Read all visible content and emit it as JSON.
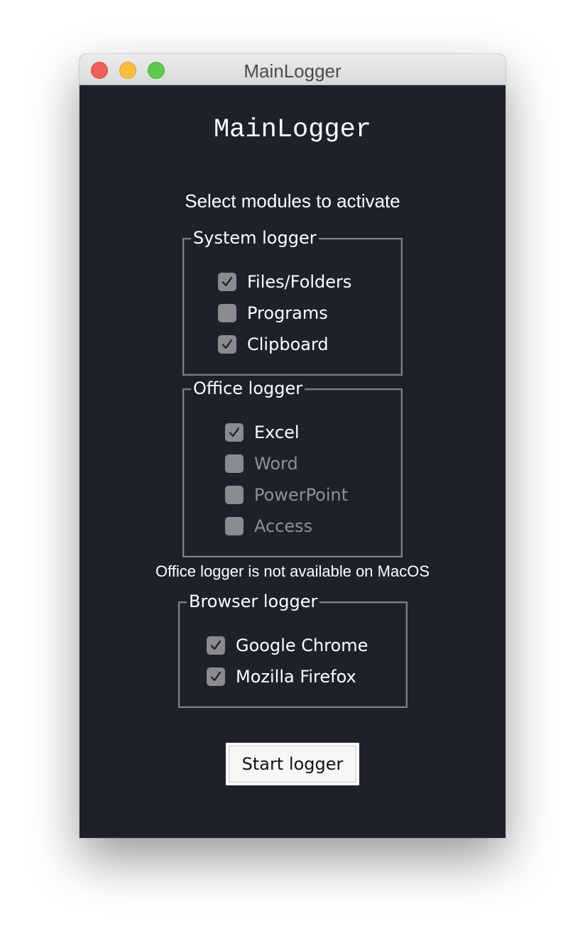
{
  "window": {
    "title": "MainLogger"
  },
  "app": {
    "title": "MainLogger",
    "subtitle": "Select modules to activate"
  },
  "system_logger": {
    "legend": "System logger",
    "items": [
      {
        "label": "Files/Folders",
        "checked": true,
        "enabled": true
      },
      {
        "label": "Programs",
        "checked": false,
        "enabled": true
      },
      {
        "label": "Clipboard",
        "checked": true,
        "enabled": true
      }
    ]
  },
  "office_logger": {
    "legend": "Office logger",
    "items": [
      {
        "label": "Excel",
        "checked": true,
        "enabled": true
      },
      {
        "label": "Word",
        "checked": false,
        "enabled": false
      },
      {
        "label": "PowerPoint",
        "checked": false,
        "enabled": false
      },
      {
        "label": "Access",
        "checked": false,
        "enabled": false
      }
    ],
    "note": "Office logger is not available on MacOS"
  },
  "browser_logger": {
    "legend": "Browser logger",
    "items": [
      {
        "label": "Google Chrome",
        "checked": true,
        "enabled": true
      },
      {
        "label": "Mozilla Firefox",
        "checked": true,
        "enabled": true
      }
    ]
  },
  "actions": {
    "start_label": "Start logger"
  },
  "colors": {
    "background": "#1c212b",
    "checkbox": "#8a8b8f",
    "close": "#ee5f58",
    "minimize": "#f8bd3d",
    "maximize": "#5fc84e"
  }
}
